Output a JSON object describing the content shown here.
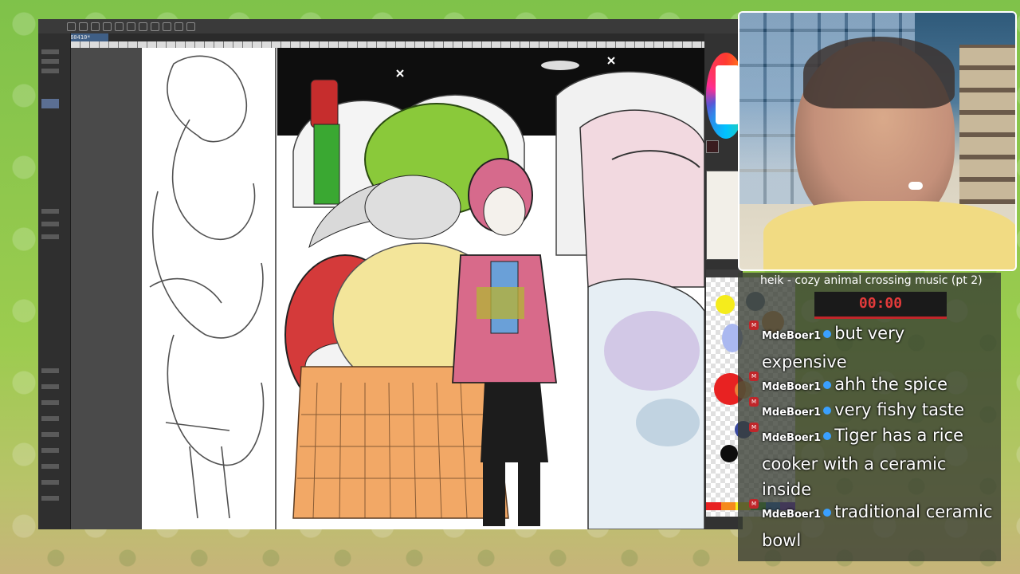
{
  "app": {
    "tab_label": "260410*",
    "colors": {
      "toolbar": "#3a3a3a",
      "panel": "#2f2f2f",
      "selection": "#5b6f93"
    }
  },
  "canvas": {
    "description_colors": {
      "beanie": "#8ac93a",
      "skirt": "#f0a060",
      "jacket": "#d86a8a",
      "bottle": "#c62d2d"
    }
  },
  "stream": {
    "title": "heik - cozy animal crossing music (pt 2)",
    "timer": "00:00",
    "accent": "#e23a3a"
  },
  "chat": {
    "messages": [
      {
        "user": "MdeBoer1",
        "text": "but very expensive"
      },
      {
        "user": "MdeBoer1",
        "text": "ahh the spice"
      },
      {
        "user": "MdeBoer1",
        "text": "very fishy taste"
      },
      {
        "user": "MdeBoer1",
        "text": "Tiger has a rice cooker with a ceramic inside"
      },
      {
        "user": "MdeBoer1",
        "text": "traditional ceramic bowl"
      }
    ]
  }
}
